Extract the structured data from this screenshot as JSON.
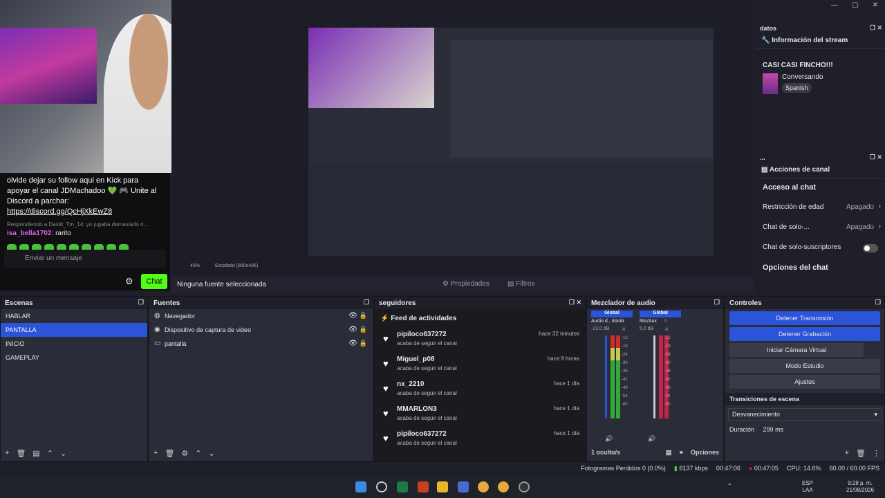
{
  "chat": {
    "message": "olvide dejar su follow aqui en Kick para apoyar el canal JDMachadoo 💚 🎮 Unite al Discord a parchar:",
    "link": "https://discord.gg/QcHjXkEwZ8",
    "reply": "Respondiendo a David_Tm_14: yo jugaba demasiado ri...",
    "user": "isa_bella1702",
    "user_msg": "rarito",
    "input_placeholder": "Enviar un mensaje",
    "chat_button": "Chat"
  },
  "zoom": {
    "percent": "45%",
    "scaled": "Escalado (880x495)"
  },
  "source_bar": {
    "none": "Ninguna fuente seleccionada",
    "props": "Propiedades",
    "filters": "Filtros"
  },
  "datos": {
    "title": "datos",
    "info_title": "Información del stream",
    "stream_title": "CASI CASI FINCHO!!!",
    "category": "Conversando",
    "tag": "Spanish"
  },
  "acciones": {
    "title": "...",
    "header": "Acciones de canal",
    "chat_access": "Acceso al chat",
    "age_label": "Restricción de edad",
    "age_val": "Apagado",
    "solo_label": "Chat de solo-...",
    "solo_val": "Apagado",
    "subs_label": "Chat de solo-suscriptores",
    "options": "Opciones del chat"
  },
  "escenas": {
    "title": "Escenas",
    "items": [
      "HABLAR",
      "PANTALLA",
      "INICIO",
      "GAMEPLAY"
    ]
  },
  "fuentes": {
    "title": "Fuentes",
    "items": [
      "Navegador",
      "Dispositivo de captura de video",
      "pantalla"
    ]
  },
  "seguidores": {
    "title": "seguidores",
    "feed": "Feed de actividades",
    "action": "acaba de seguir el canal",
    "items": [
      {
        "user": "pipiloco637272",
        "time": "hace 32 minutos"
      },
      {
        "user": "Miguel_p08",
        "time": "hace 9 horas"
      },
      {
        "user": "nx_2210",
        "time": "hace 1 día"
      },
      {
        "user": "MMARLON3",
        "time": "hace 1 día"
      },
      {
        "user": "pipiloco637272",
        "time": "hace 1 día"
      }
    ]
  },
  "mezclador": {
    "title": "Mezclador de audio",
    "col1": {
      "global": "Global",
      "name": "Audio d...ritorio",
      "db": "-23.0 dB"
    },
    "col2": {
      "global": "Global",
      "name": "Mic/Aux",
      "db": "5.0 dB"
    },
    "hidden": "1 oculto/s",
    "options": "Opciones",
    "scale": [
      "0",
      "-6",
      "-12",
      "-18",
      "-24",
      "-30",
      "-36",
      "-42",
      "-48",
      "-54",
      "-60"
    ]
  },
  "controles": {
    "title": "Controles",
    "stop_stream": "Detener Transmisión",
    "stop_rec": "Detener Grabación",
    "virtual_cam": "Iniciar Cámara Virtual",
    "studio": "Modo Estudio",
    "settings": "Ajustes",
    "transitions": "Transiciones de escena",
    "transition": "Desvanecimiento",
    "duration_label": "Duración",
    "duration": "299 ms"
  },
  "status": {
    "dropped": "Fotogramas Perdidos 0 (0.0%)",
    "kbps": "6137 kbps",
    "stream_time": "00:47:06",
    "rec_time": "00:47:05",
    "cpu": "CPU: 14.6%",
    "fps": "60.00 / 60.00 FPS"
  },
  "taskbar": {
    "lang": "ESP",
    "lang2": "LAA",
    "time": "9:28 p. m.",
    "date": "21/08/2026"
  },
  "colors": {
    "accent": "#2b54d8",
    "kick_green": "#53fc18",
    "follower_heart": "#ffffff"
  }
}
